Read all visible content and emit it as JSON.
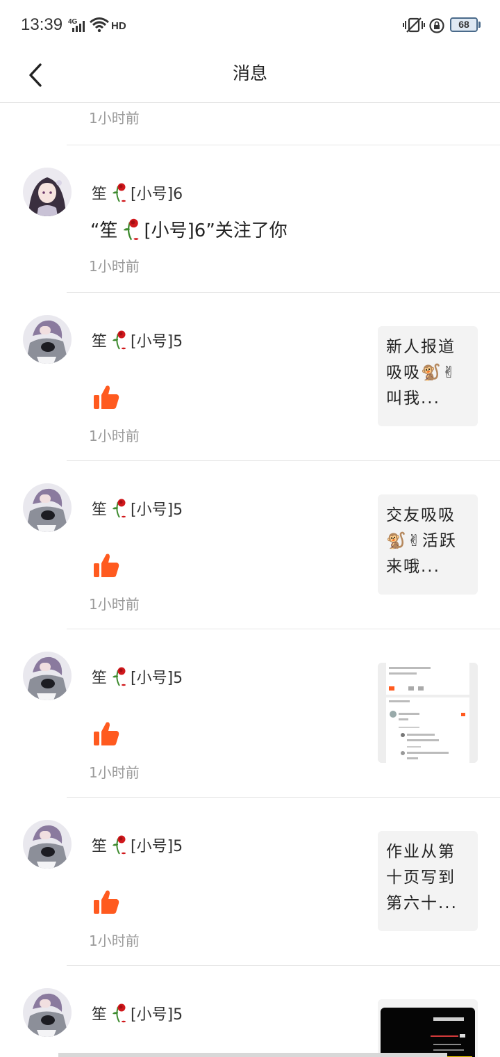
{
  "status_bar": {
    "time": "13:39",
    "network": "4G",
    "hd": "HD",
    "battery": "68"
  },
  "nav": {
    "title": "消息"
  },
  "top_partial": {
    "time": "1小时前"
  },
  "follow_item": {
    "username_prefix": "笙",
    "username_suffix": "[小号]6",
    "message_open": "“笙",
    "message_close": "[小号]6”关注了你",
    "time": "1小时前"
  },
  "like_items": [
    {
      "username_prefix": "笙",
      "username_suffix": "[小号]5",
      "time": "1小时前",
      "thumb_text": "新人报道吸吸🐒✌叫我..."
    },
    {
      "username_prefix": "笙",
      "username_suffix": "[小号]5",
      "time": "1小时前",
      "thumb_text": "交友吸吸🐒✌活跃来哦..."
    },
    {
      "username_prefix": "笙",
      "username_suffix": "[小号]5",
      "time": "1小时前",
      "thumb_text": ""
    },
    {
      "username_prefix": "笙",
      "username_suffix": "[小号]5",
      "time": "1小时前",
      "thumb_text": "作业从第十页写到第六十..."
    },
    {
      "username_prefix": "笙",
      "username_suffix": "[小号]5",
      "time": "",
      "thumb_text": ""
    }
  ],
  "colors": {
    "accent_like": "#ff5a1f",
    "time_gray": "#9a9a9a",
    "rose_red": "#d0181c",
    "rose_green": "#3d8a2e"
  },
  "icons": {
    "back": "chevron-left-icon",
    "like": "thumbs-up-icon",
    "rose": "wilted-rose-icon"
  }
}
